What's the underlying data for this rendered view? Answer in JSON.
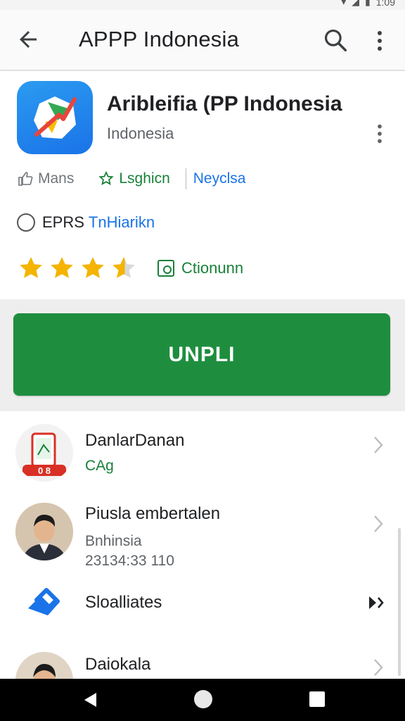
{
  "statusbar": {
    "battery_text": "1:09"
  },
  "appbar": {
    "title": "APPP Indonesia",
    "back_icon": "arrow-back-icon",
    "search_icon": "search-icon",
    "more_icon": "more-vert-icon"
  },
  "app": {
    "name": "Aribleifia (PP Indonesia",
    "subtitle": "Indonesia",
    "icon": "app-logo-icon",
    "meta": {
      "likes_label": "Mans",
      "tag_label": "Lsghicn",
      "link_label": "Neyclsa"
    },
    "rating_line": {
      "prefix": "EPRS",
      "accent": "TnHiarikn"
    },
    "stars": {
      "value": 3.5,
      "max": 5
    },
    "install_tag_label": "Ctionunn"
  },
  "install_button": {
    "label": "UNPLI"
  },
  "list": [
    {
      "title": "DanlarDanan",
      "subtitle": "CAg",
      "avatar": "phone-map-icon"
    },
    {
      "title": "Piusla embertalen",
      "subtitle": "Bnhinsia",
      "extra": "23134:33 110",
      "avatar": "person-photo"
    },
    {
      "title": "Sloalliates",
      "avatar": "tag-icon"
    },
    {
      "title": "Daiokala",
      "avatar": "person-photo"
    }
  ],
  "colors": {
    "accent_green": "#1e8e3e",
    "link_blue": "#1a73e8",
    "star": "#f4b400"
  }
}
